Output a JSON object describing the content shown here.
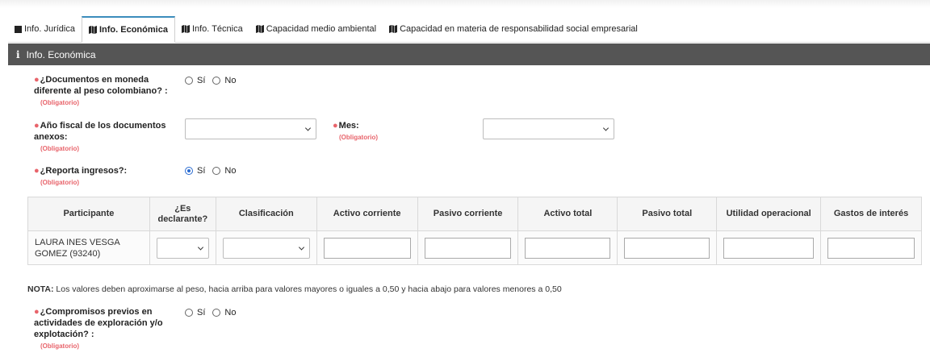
{
  "tabs": [
    {
      "label": "Info. Jurídica",
      "icon": "square-icon"
    },
    {
      "label": "Info. Económica",
      "icon": "map-icon",
      "active": true
    },
    {
      "label": "Info. Técnica",
      "icon": "map-icon"
    },
    {
      "label": "Capacidad medio ambiental",
      "icon": "map-icon"
    },
    {
      "label": "Capacidad en materia de responsabilidad social empresarial",
      "icon": "map-icon"
    }
  ],
  "section": {
    "icon": "i",
    "title": "Info. Económica"
  },
  "required_text": "(Obligatorio)",
  "radio": {
    "yes": "Sí",
    "no": "No"
  },
  "questions": {
    "moneda": {
      "label": "¿Documentos en moneda diferente al peso colombiano? :",
      "selected": null
    },
    "anio": {
      "label": "Año fiscal de los documentos anexos:",
      "value": ""
    },
    "mes": {
      "label": "Mes:",
      "value": ""
    },
    "ingresos": {
      "label": "¿Reporta ingresos?:",
      "selected": "Sí"
    },
    "compromisos": {
      "label": "¿Compromisos previos en actividades de exploración y/o explotación? :",
      "selected": null
    }
  },
  "table": {
    "headers": [
      "Participante",
      "¿Es declarante?",
      "Clasificación",
      "Activo corriente",
      "Pasivo corriente",
      "Activo total",
      "Pasivo total",
      "Utilidad operacional",
      "Gastos de interés"
    ],
    "rows": [
      {
        "participante": "LAURA INES VESGA GOMEZ (93240)",
        "declarante": "",
        "clasificacion": "",
        "activo_corriente": "",
        "pasivo_corriente": "",
        "activo_total": "",
        "pasivo_total": "",
        "utilidad_operacional": "",
        "gastos_interes": ""
      }
    ]
  },
  "note": {
    "label": "NOTA:",
    "text": " Los valores deben aproximarse al peso, hacia arriba para valores mayores o iguales a 0,50 y hacia abajo para valores menores a 0,50"
  },
  "colors": {
    "accent": "#3c8dbc",
    "header_bg": "#555555",
    "required": "#e8646b",
    "radio_on": "#2a6bd1"
  }
}
